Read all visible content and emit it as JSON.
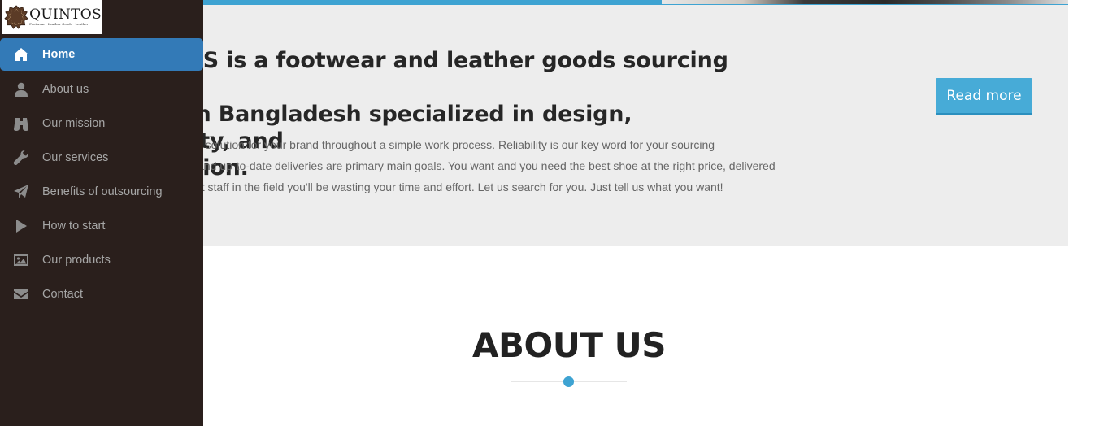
{
  "logo": {
    "name": "QUINTOS",
    "tagline": "Footwear · Leather Goods · Leather"
  },
  "nav": {
    "items": [
      {
        "label": "Home",
        "icon": "home-icon",
        "active": true
      },
      {
        "label": "About us",
        "icon": "user-icon",
        "active": false
      },
      {
        "label": "Our mission",
        "icon": "binoculars-icon",
        "active": false
      },
      {
        "label": "Our services",
        "icon": "wrench-icon",
        "active": false
      },
      {
        "label": "Benefits of outsourcing",
        "icon": "paper-plane-icon",
        "active": false
      },
      {
        "label": "How to start",
        "icon": "play-icon",
        "active": false
      },
      {
        "label": "Our products",
        "icon": "picture-icon",
        "active": false
      },
      {
        "label": "Contact",
        "icon": "envelope-icon",
        "active": false
      }
    ]
  },
  "intro": {
    "heading_line1": "QUINTOS is a footwear and leather goods sourcing agency",
    "heading_line2": "based in Bangladesh specialized in design, creativity, and",
    "heading_line3": "production.",
    "text_line1": "We offer the best market solution for your brand throughout a simple work process. Reliability is our key word for your sourcing",
    "text_line2": "needs; professionalism and up-to-date deliveries are primary main goals. You want and you need the best shoe at the right price, delivered",
    "text_line3": "on time. Without the right staff in the field you'll be wasting your time and effort. Let us search for you. Just tell us what you want!",
    "read_more_label": "Read more"
  },
  "about": {
    "title": "ABOUT US"
  },
  "colors": {
    "accent": "#3ea3d2",
    "active_nav": "#337ab7",
    "sidebar_bg": "#2a1f1c",
    "intro_bg": "#ededed"
  }
}
